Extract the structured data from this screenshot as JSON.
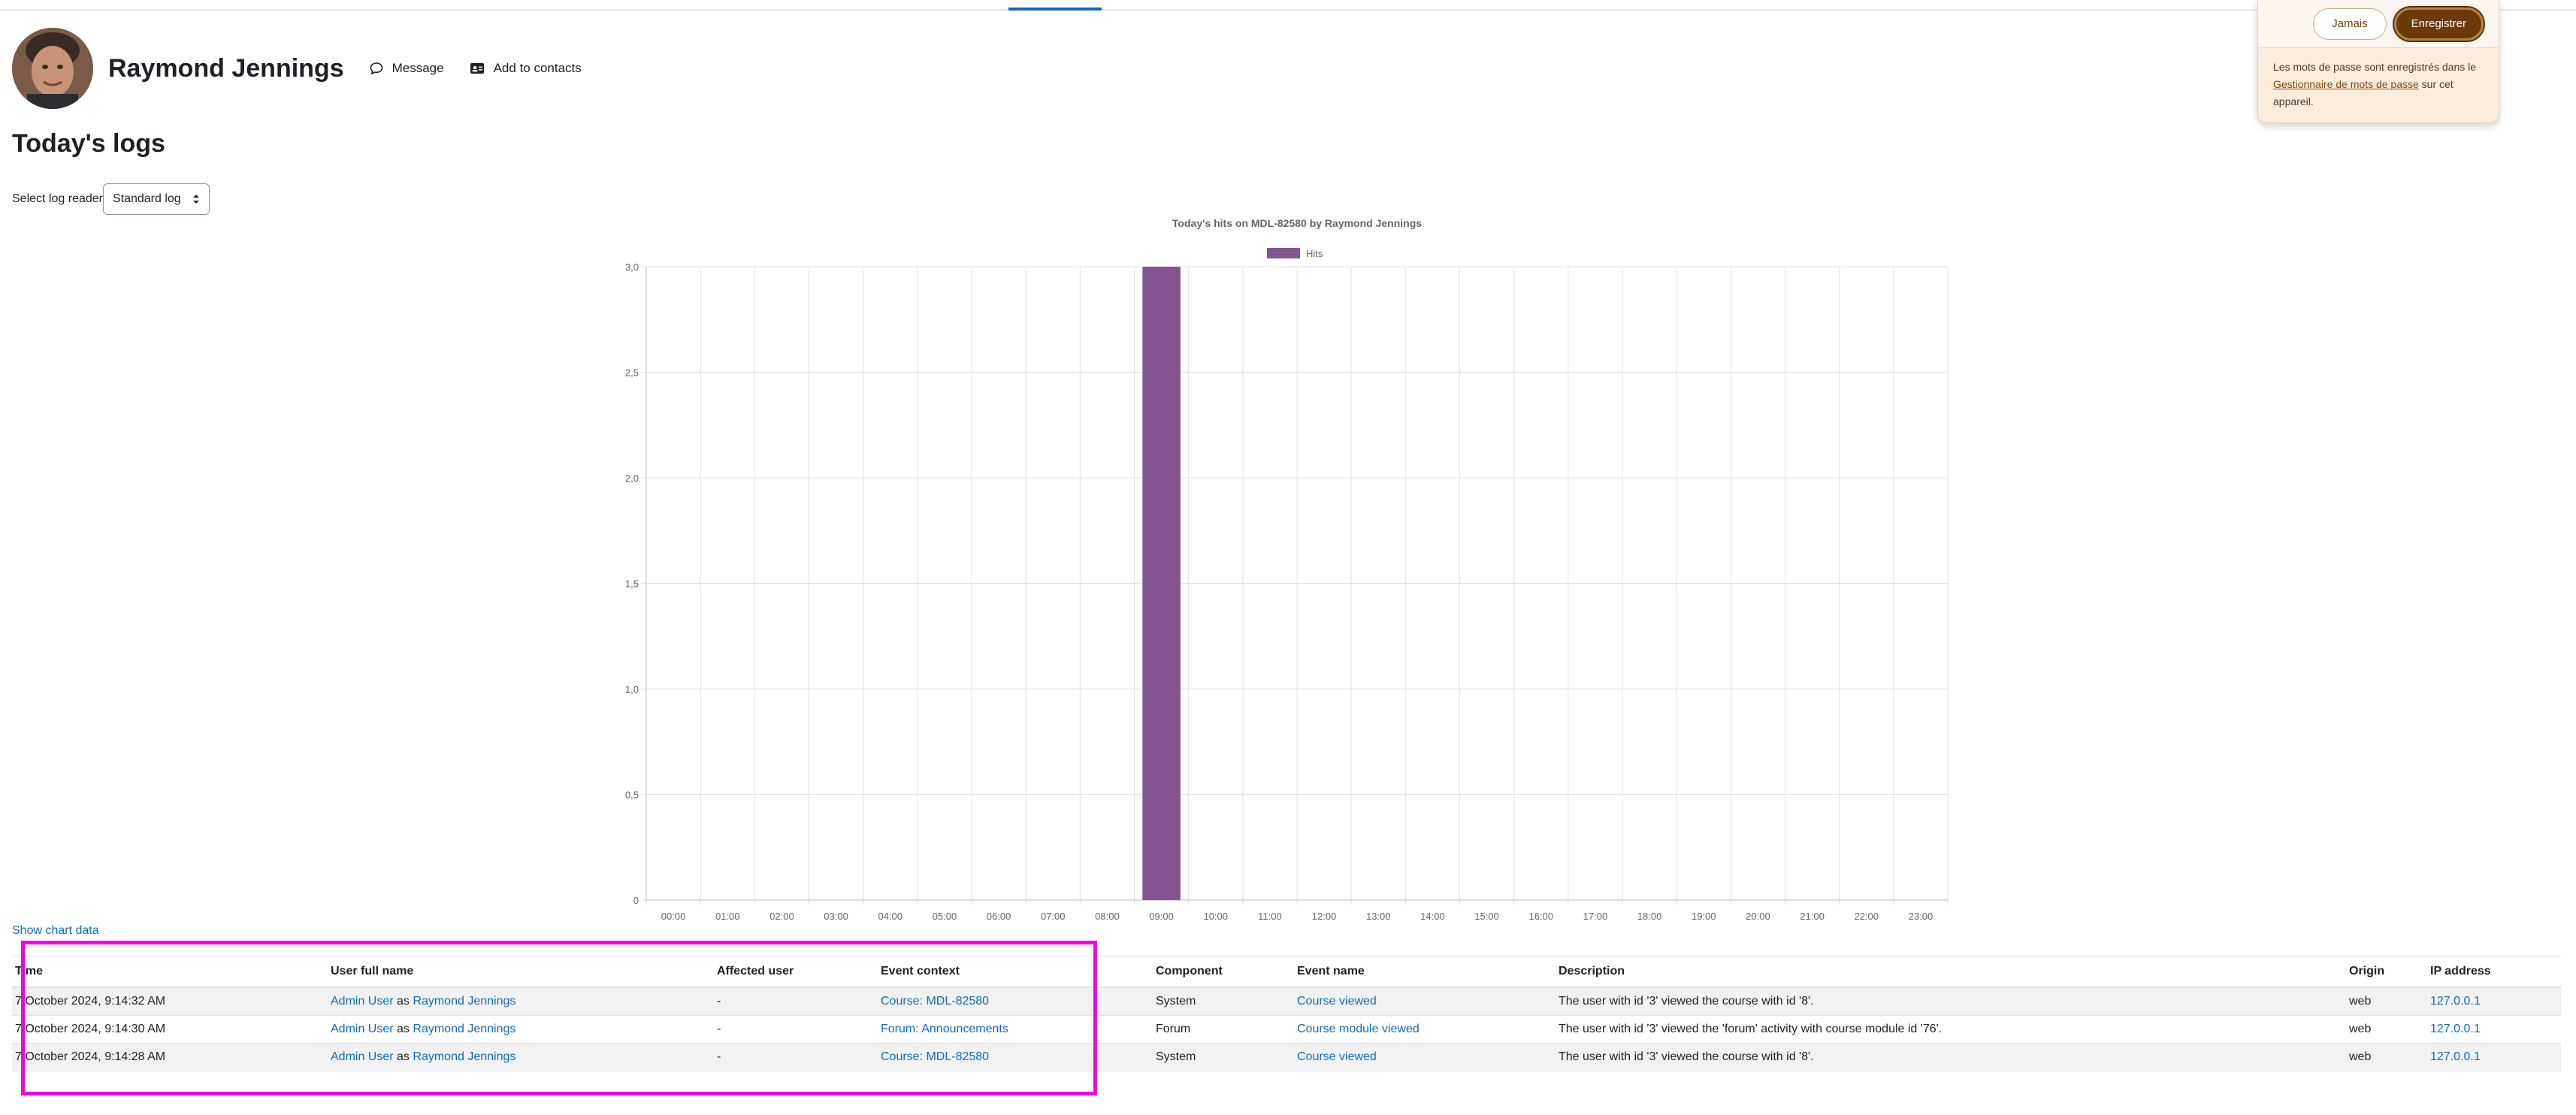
{
  "header": {
    "user_name": "Raymond Jennings",
    "message_label": "Message",
    "add_contacts_label": "Add to contacts"
  },
  "page": {
    "title": "Today's logs",
    "log_reader_label": "Select log reader",
    "log_reader_value": "Standard log",
    "show_chart_data": "Show chart data"
  },
  "chart_data": {
    "type": "bar",
    "title": "Today's hits on MDL-82580 by Raymond Jennings",
    "legend": "top-center",
    "series": [
      {
        "name": "Hits",
        "color": "#855493",
        "values": [
          0,
          0,
          0,
          0,
          0,
          0,
          0,
          0,
          0,
          3,
          0,
          0,
          0,
          0,
          0,
          0,
          0,
          0,
          0,
          0,
          0,
          0,
          0,
          0
        ]
      }
    ],
    "categories": [
      "00:00",
      "01:00",
      "02:00",
      "03:00",
      "04:00",
      "05:00",
      "06:00",
      "07:00",
      "08:00",
      "09:00",
      "10:00",
      "11:00",
      "12:00",
      "13:00",
      "14:00",
      "15:00",
      "16:00",
      "17:00",
      "18:00",
      "19:00",
      "20:00",
      "21:00",
      "22:00",
      "23:00"
    ],
    "ylim": [
      0,
      3
    ],
    "yticks": [
      "0",
      "0,5",
      "1,0",
      "1,5",
      "2,0",
      "2,5",
      "3,0"
    ],
    "grid": true
  },
  "table": {
    "headers": [
      "Time",
      "User full name",
      "Affected user",
      "Event context",
      "Component",
      "Event name",
      "Description",
      "Origin",
      "IP address"
    ],
    "rows": [
      {
        "time": "7 October 2024, 9:14:32 AM",
        "real_user": "Admin User",
        "as": "as",
        "user": "Raymond Jennings",
        "affected": "-",
        "context": "Course: MDL-82580",
        "component": "System",
        "event": "Course viewed",
        "description": "The user with id '3' viewed the course with id '8'.",
        "origin": "web",
        "ip": "127.0.0.1"
      },
      {
        "time": "7 October 2024, 9:14:30 AM",
        "real_user": "Admin User",
        "as": "as",
        "user": "Raymond Jennings",
        "affected": "-",
        "context": "Forum: Announcements",
        "component": "Forum",
        "event": "Course module viewed",
        "description": "The user with id '3' viewed the 'forum' activity with course module id '76'.",
        "origin": "web",
        "ip": "127.0.0.1"
      },
      {
        "time": "7 October 2024, 9:14:28 AM",
        "real_user": "Admin User",
        "as": "as",
        "user": "Raymond Jennings",
        "affected": "-",
        "context": "Course: MDL-82580",
        "component": "System",
        "event": "Course viewed",
        "description": "The user with id '3' viewed the course with id '8'.",
        "origin": "web",
        "ip": "127.0.0.1"
      }
    ]
  },
  "password_popup": {
    "never_label": "Jamais",
    "save_label": "Enregistrer",
    "message_pre": "Les mots de passe sont enregistrés dans le ",
    "message_link": "Gestionnaire de mots de passe",
    "message_post": " sur cet appareil."
  }
}
